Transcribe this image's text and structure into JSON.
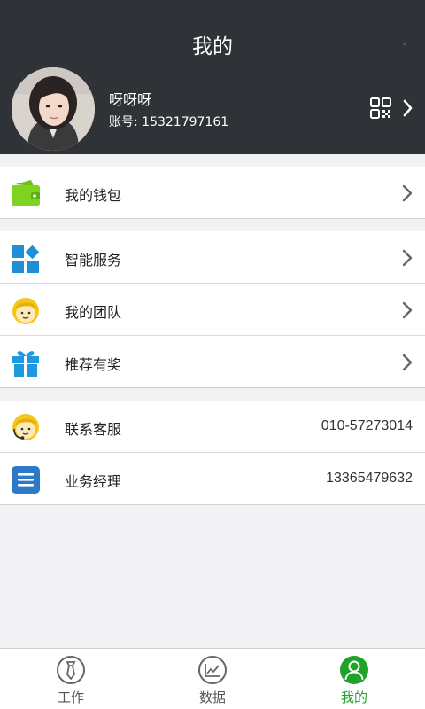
{
  "header": {
    "title": "我的",
    "profile": {
      "name": "呀呀呀",
      "account": "账号: 15321797161"
    }
  },
  "groups": [
    {
      "items": [
        {
          "label": "我的钱包",
          "icon": "wallet-icon"
        }
      ]
    },
    {
      "items": [
        {
          "label": "智能服务",
          "icon": "smart-service-icon"
        },
        {
          "label": "我的团队",
          "icon": "team-icon"
        },
        {
          "label": "推荐有奖",
          "icon": "gift-icon"
        }
      ]
    },
    {
      "items": [
        {
          "label": "联系客服",
          "value": "010-57273014",
          "icon": "customer-service-icon"
        },
        {
          "label": "业务经理",
          "value": "13365479632",
          "icon": "manager-icon"
        }
      ]
    }
  ],
  "tabbar": {
    "tabs": [
      {
        "label": "工作",
        "icon": "work-icon",
        "active": false
      },
      {
        "label": "数据",
        "icon": "data-chart-icon",
        "active": false
      },
      {
        "label": "我的",
        "icon": "profile-icon",
        "active": true
      }
    ]
  },
  "colors": {
    "header_bg": "#2f3338",
    "accent_green": "#1fa32a",
    "wallet_green": "#7ed321",
    "service_blue": "#1e8fd6",
    "face_yellow": "#f5c518"
  }
}
